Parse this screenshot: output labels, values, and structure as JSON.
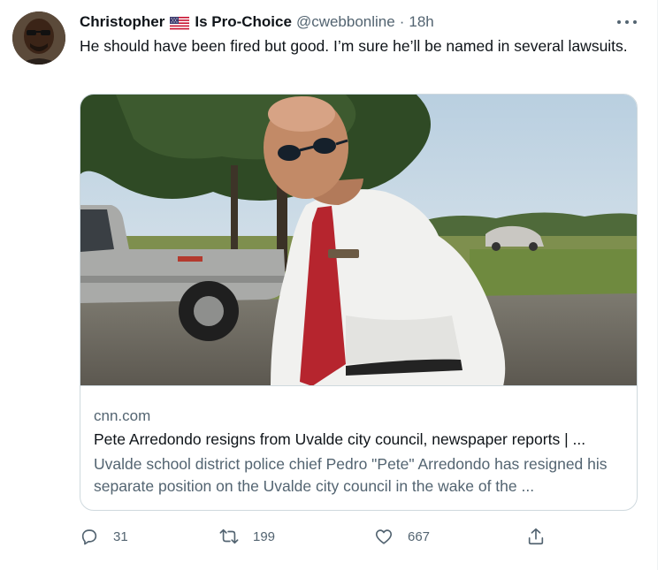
{
  "tweet": {
    "display_name": "Christopher",
    "name_suffix": "Is Pro-Choice",
    "handle": "@cwebbonline",
    "separator": "·",
    "time": "18h",
    "text": "He should have been fired but good. I’m sure he’ll be named in several lawsuits.",
    "flag_icon": "us-flag-icon"
  },
  "card": {
    "domain": "cnn.com",
    "title": "Pete Arredondo resigns from Uvalde city council, newspaper reports | ...",
    "description": "Uvalde school district police chief Pedro \"Pete\" Arredondo has resigned his separate position on the Uvalde city council in the wake of the ..."
  },
  "actions": {
    "reply_count": "31",
    "retweet_count": "199",
    "like_count": "667"
  },
  "colors": {
    "text_primary": "#0f1419",
    "text_secondary": "#536471",
    "border": "#cfd9de"
  }
}
